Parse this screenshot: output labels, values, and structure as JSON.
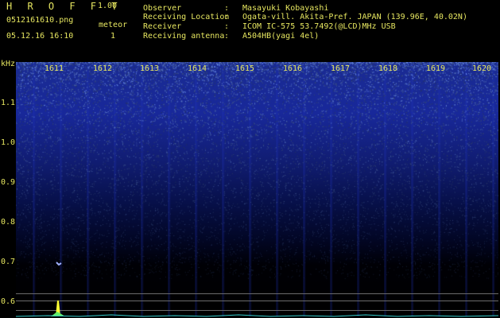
{
  "header": {
    "app_title": "H R O F F T",
    "app_version": "1.00",
    "filename": "0512161610.png",
    "datetime": "05.12.16 16:10",
    "meteor_label": "meteor",
    "meteor_count": "1"
  },
  "info": [
    {
      "key": "Observer",
      "sep": ":",
      "value": "Masayuki Kobayashi"
    },
    {
      "key": "Receiving Location",
      "sep": ":",
      "value": "Ogata-vill. Akita-Pref. JAPAN (139.96E, 40.02N)"
    },
    {
      "key": "Receiver",
      "sep": ":",
      "value": "ICOM IC-575 53.7492(@LCD)MHz USB"
    },
    {
      "key": "Receiving antenna",
      "sep": ":",
      "value": "A504HB(yagi 4el)"
    }
  ],
  "spectrogram": {
    "y_unit": "kHz",
    "y_ticks": [
      "1.1",
      "1.0",
      "0.9",
      "0.8",
      "0.7",
      "0.6"
    ],
    "x_labels": [
      "1611",
      "1612",
      "1613",
      "1614",
      "1615",
      "1616",
      "1617",
      "1618",
      "1619",
      "1620"
    ],
    "colors": {
      "background": "#000000",
      "signal": "#1e2fae",
      "bright": "#6f8cff",
      "text": "#e6e660"
    }
  }
}
